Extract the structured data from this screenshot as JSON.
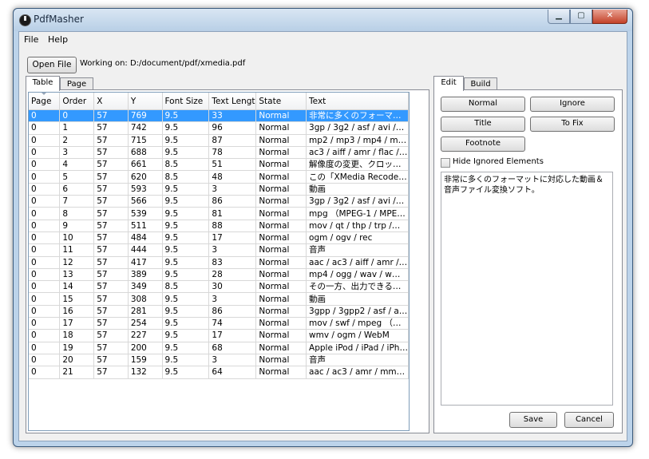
{
  "window": {
    "title": "PdfMasher",
    "minimize": "▁",
    "maximize": "▢",
    "close": "✕"
  },
  "menu": {
    "file": "File",
    "help": "Help"
  },
  "toolbar": {
    "open_file": "Open File",
    "working_on": "Working on: D:/document/pdf/xmedia.pdf"
  },
  "left_tabs": {
    "table": "Table",
    "page": "Page"
  },
  "table": {
    "columns": [
      "Page",
      "Order",
      "X",
      "Y",
      "Font Size",
      "Text Lengt",
      "State",
      "Text"
    ],
    "rows": [
      [
        "0",
        "0",
        "57",
        "769",
        "9.5",
        "33",
        "Normal",
        "非常に多くのフォーマ…"
      ],
      [
        "0",
        "1",
        "57",
        "742",
        "9.5",
        "96",
        "Normal",
        "3gp / 3g2 / asf / avi /…"
      ],
      [
        "0",
        "2",
        "57",
        "715",
        "9.5",
        "87",
        "Normal",
        "mp2 / mp3 / mp4 / m…"
      ],
      [
        "0",
        "3",
        "57",
        "688",
        "9.5",
        "78",
        "Normal",
        "ac3 / aiff / amr / flac /…"
      ],
      [
        "0",
        "4",
        "57",
        "661",
        "8.5",
        "51",
        "Normal",
        "解像度の変更、クロッ…"
      ],
      [
        "0",
        "5",
        "57",
        "620",
        "8.5",
        "48",
        "Normal",
        "この「XMedia Recode…"
      ],
      [
        "0",
        "6",
        "57",
        "593",
        "9.5",
        "3",
        "Normal",
        "動画"
      ],
      [
        "0",
        "7",
        "57",
        "566",
        "9.5",
        "86",
        "Normal",
        "3gp / 3g2 / asf / avi /…"
      ],
      [
        "0",
        "8",
        "57",
        "539",
        "9.5",
        "81",
        "Normal",
        " mpg （MPEG-1 / MPE…"
      ],
      [
        "0",
        "9",
        "57",
        "511",
        "9.5",
        "88",
        "Normal",
        " mov / qt / thp / trp /…"
      ],
      [
        "0",
        "10",
        "57",
        "484",
        "9.5",
        "17",
        "Normal",
        " ogm / ogv / rec"
      ],
      [
        "0",
        "11",
        "57",
        "444",
        "9.5",
        "3",
        "Normal",
        "音声"
      ],
      [
        "0",
        "12",
        "57",
        "417",
        "9.5",
        "83",
        "Normal",
        "aac / ac3 / aiff / amr /…"
      ],
      [
        "0",
        "13",
        "57",
        "389",
        "9.5",
        "28",
        "Normal",
        " mp4 / ogg / wav / w…"
      ],
      [
        "0",
        "14",
        "57",
        "349",
        "8.5",
        "30",
        "Normal",
        "その一方、出力できる…"
      ],
      [
        "0",
        "15",
        "57",
        "308",
        "9.5",
        "3",
        "Normal",
        "動画"
      ],
      [
        "0",
        "16",
        "57",
        "281",
        "9.5",
        "86",
        "Normal",
        "3gpp / 3gpp2 / asf / a…"
      ],
      [
        "0",
        "17",
        "57",
        "254",
        "9.5",
        "74",
        "Normal",
        " mov / swf / mpeg （…"
      ],
      [
        "0",
        "18",
        "57",
        "227",
        "9.5",
        "17",
        "Normal",
        "wmv / ogm / WebM"
      ],
      [
        "0",
        "19",
        "57",
        "200",
        "9.5",
        "68",
        "Normal",
        "Apple iPod / iPad / iPh…"
      ],
      [
        "0",
        "20",
        "57",
        "159",
        "9.5",
        "3",
        "Normal",
        "音声"
      ],
      [
        "0",
        "21",
        "57",
        "132",
        "9.5",
        "64",
        "Normal",
        "aac / ac3 / amr / mm…"
      ]
    ]
  },
  "right_tabs": {
    "edit": "Edit",
    "build": "Build"
  },
  "edit": {
    "normal": "Normal",
    "ignore": "Ignore",
    "title": "Title",
    "to_fix": "To Fix",
    "footnote": "Footnote",
    "hide_ignored": "Hide Ignored Elements",
    "text": "非常に多くのフォーマットに対応した動画＆音声ファイル変換ソフト。",
    "save": "Save",
    "cancel": "Cancel"
  }
}
